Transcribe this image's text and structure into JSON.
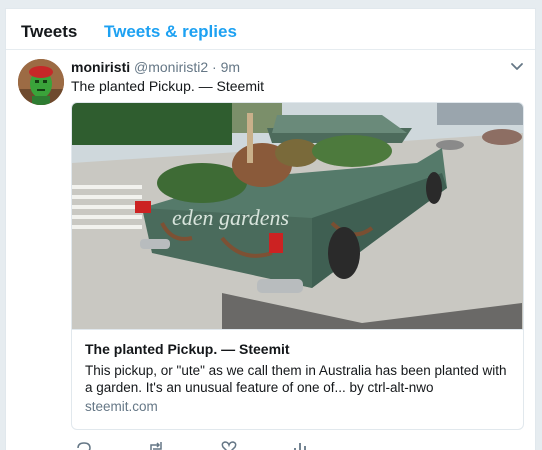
{
  "tabs": [
    {
      "label": "Tweets"
    },
    {
      "label": "Tweets & replies"
    }
  ],
  "tweet": {
    "author_name": "moniristi",
    "author_handle": "@moniristi2",
    "separator": "·",
    "timestamp": "9m",
    "text": "The planted Pickup. — Steemit",
    "card": {
      "title": "The planted Pickup. — Steemit",
      "description": "This pickup, or \"ute\" as we call them in Australia has been planted with a garden. It's an unusual feature of one of... by ctrl-alt-nwo",
      "domain": "steemit.com",
      "image_text": "eden gardens"
    },
    "icons": {
      "menu": "chevron-down-icon",
      "reply": "reply-icon",
      "retweet": "retweet-icon",
      "like": "heart-icon",
      "analytics": "analytics-icon"
    }
  },
  "colors": {
    "accent": "#1da1f2",
    "text": "#14171a",
    "muted": "#657786",
    "background": "#e6ecf0"
  }
}
